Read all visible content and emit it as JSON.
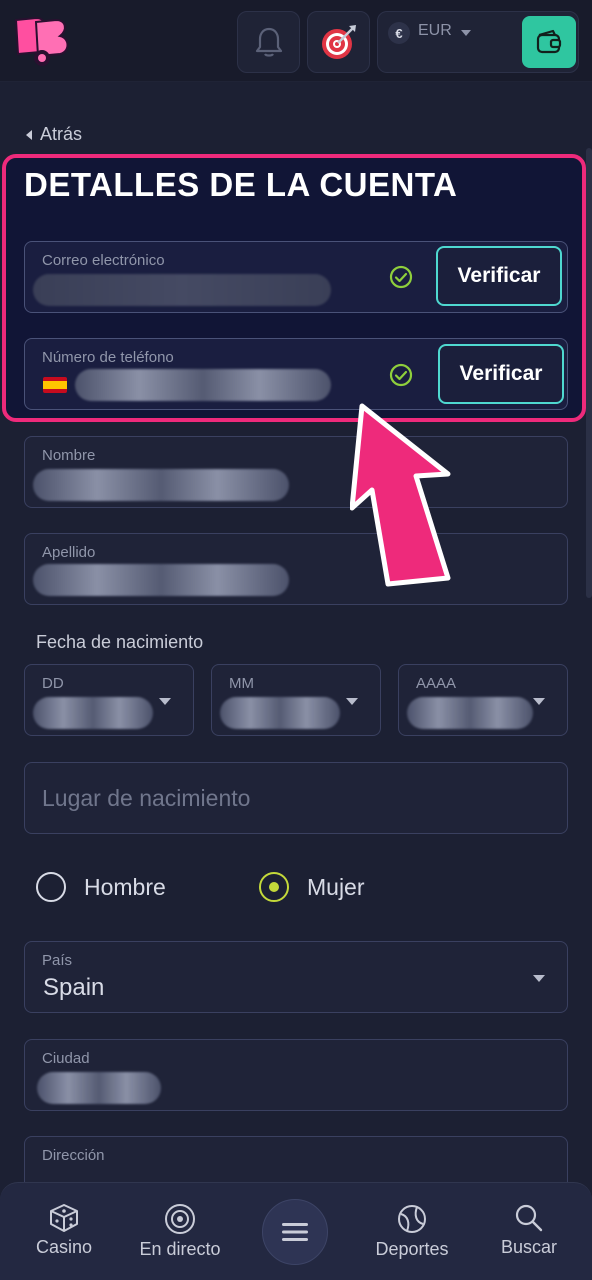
{
  "header": {
    "currency_symbol": "€",
    "currency": "EUR"
  },
  "back": {
    "label": "Atrás"
  },
  "title": "DETALLES DE LA CUENTA",
  "email": {
    "label": "Correo electrónico",
    "verify_label": "Verificar"
  },
  "phone": {
    "label": "Número de teléfono",
    "verify_label": "Verificar"
  },
  "first_name": {
    "label": "Nombre"
  },
  "last_name": {
    "label": "Apellido"
  },
  "birth": {
    "label": "Fecha de nacimiento",
    "day": "DD",
    "month": "MM",
    "year": "AAAA"
  },
  "birthplace": {
    "placeholder": "Lugar de nacimiento"
  },
  "gender": {
    "male": "Hombre",
    "female": "Mujer",
    "selected": "female"
  },
  "country": {
    "label": "País",
    "value": "Spain"
  },
  "city": {
    "label": "Ciudad"
  },
  "address": {
    "label": "Dirección"
  },
  "nav": {
    "casino": "Casino",
    "live": "En directo",
    "sports": "Deportes",
    "search": "Buscar"
  },
  "colors": {
    "accent_teal": "#2fc6a0",
    "highlight_pink": "#ee2a7b",
    "check_green": "#8fcf3c",
    "radio_selected": "#c4d93a"
  }
}
